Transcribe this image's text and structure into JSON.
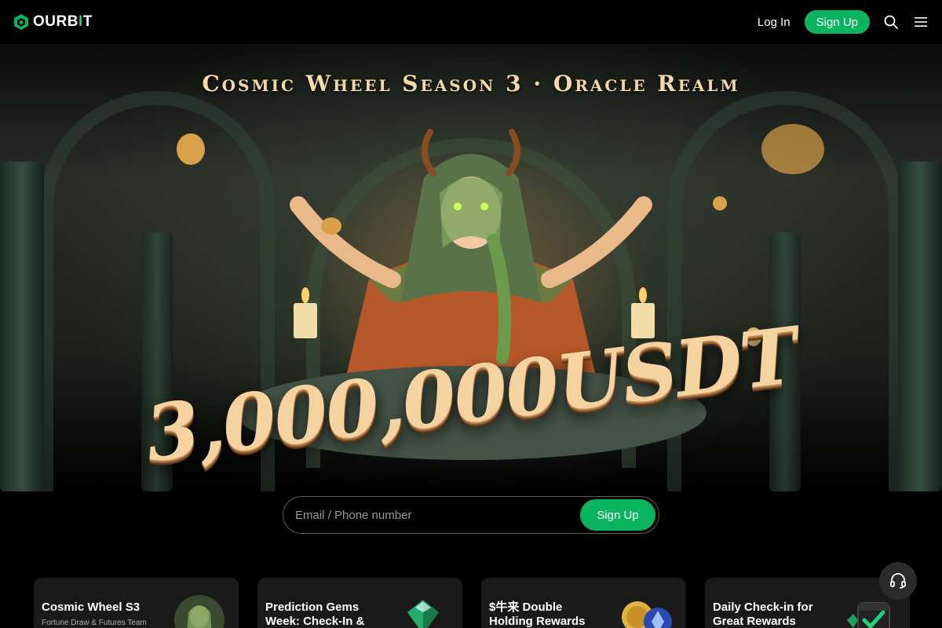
{
  "header": {
    "logo_text_a": "OURB",
    "logo_text_i": "I",
    "logo_text_b": "T",
    "login_label": "Log In",
    "signup_label": "Sign Up",
    "icons": [
      "search-icon",
      "menu-icon"
    ],
    "accent": "#0bb55f"
  },
  "hero": {
    "title": "Cosmic Wheel Season 3 · Oracle Realm",
    "prize": "3,000,000USDT"
  },
  "signup_form": {
    "placeholder": "Email / Phone number",
    "button_label": "Sign Up"
  },
  "cards": [
    {
      "title": "Cosmic Wheel S3",
      "subtitle": "Fortune Draw & Futures Team"
    },
    {
      "title": "Prediction Gems Week: Check-In &",
      "subtitle": ""
    },
    {
      "title": "$牛来 Double Holding Rewards",
      "subtitle": ""
    },
    {
      "title": "Daily Check-in for Great Rewards",
      "subtitle": ""
    }
  ],
  "support": {
    "icon": "headset-icon"
  }
}
